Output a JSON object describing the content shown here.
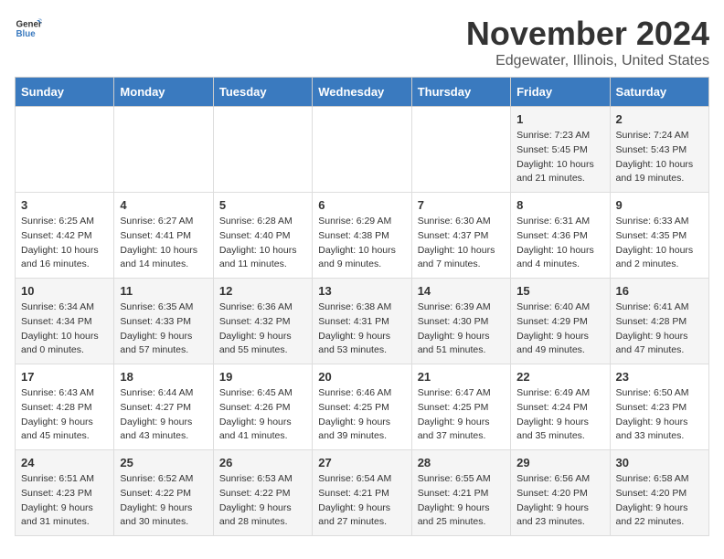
{
  "logo": {
    "general": "General",
    "blue": "Blue"
  },
  "title": "November 2024",
  "location": "Edgewater, Illinois, United States",
  "days_of_week": [
    "Sunday",
    "Monday",
    "Tuesday",
    "Wednesday",
    "Thursday",
    "Friday",
    "Saturday"
  ],
  "weeks": [
    [
      {
        "day": "",
        "info": ""
      },
      {
        "day": "",
        "info": ""
      },
      {
        "day": "",
        "info": ""
      },
      {
        "day": "",
        "info": ""
      },
      {
        "day": "",
        "info": ""
      },
      {
        "day": "1",
        "info": "Sunrise: 7:23 AM\nSunset: 5:45 PM\nDaylight: 10 hours\nand 21 minutes."
      },
      {
        "day": "2",
        "info": "Sunrise: 7:24 AM\nSunset: 5:43 PM\nDaylight: 10 hours\nand 19 minutes."
      }
    ],
    [
      {
        "day": "3",
        "info": "Sunrise: 6:25 AM\nSunset: 4:42 PM\nDaylight: 10 hours\nand 16 minutes."
      },
      {
        "day": "4",
        "info": "Sunrise: 6:27 AM\nSunset: 4:41 PM\nDaylight: 10 hours\nand 14 minutes."
      },
      {
        "day": "5",
        "info": "Sunrise: 6:28 AM\nSunset: 4:40 PM\nDaylight: 10 hours\nand 11 minutes."
      },
      {
        "day": "6",
        "info": "Sunrise: 6:29 AM\nSunset: 4:38 PM\nDaylight: 10 hours\nand 9 minutes."
      },
      {
        "day": "7",
        "info": "Sunrise: 6:30 AM\nSunset: 4:37 PM\nDaylight: 10 hours\nand 7 minutes."
      },
      {
        "day": "8",
        "info": "Sunrise: 6:31 AM\nSunset: 4:36 PM\nDaylight: 10 hours\nand 4 minutes."
      },
      {
        "day": "9",
        "info": "Sunrise: 6:33 AM\nSunset: 4:35 PM\nDaylight: 10 hours\nand 2 minutes."
      }
    ],
    [
      {
        "day": "10",
        "info": "Sunrise: 6:34 AM\nSunset: 4:34 PM\nDaylight: 10 hours\nand 0 minutes."
      },
      {
        "day": "11",
        "info": "Sunrise: 6:35 AM\nSunset: 4:33 PM\nDaylight: 9 hours\nand 57 minutes."
      },
      {
        "day": "12",
        "info": "Sunrise: 6:36 AM\nSunset: 4:32 PM\nDaylight: 9 hours\nand 55 minutes."
      },
      {
        "day": "13",
        "info": "Sunrise: 6:38 AM\nSunset: 4:31 PM\nDaylight: 9 hours\nand 53 minutes."
      },
      {
        "day": "14",
        "info": "Sunrise: 6:39 AM\nSunset: 4:30 PM\nDaylight: 9 hours\nand 51 minutes."
      },
      {
        "day": "15",
        "info": "Sunrise: 6:40 AM\nSunset: 4:29 PM\nDaylight: 9 hours\nand 49 minutes."
      },
      {
        "day": "16",
        "info": "Sunrise: 6:41 AM\nSunset: 4:28 PM\nDaylight: 9 hours\nand 47 minutes."
      }
    ],
    [
      {
        "day": "17",
        "info": "Sunrise: 6:43 AM\nSunset: 4:28 PM\nDaylight: 9 hours\nand 45 minutes."
      },
      {
        "day": "18",
        "info": "Sunrise: 6:44 AM\nSunset: 4:27 PM\nDaylight: 9 hours\nand 43 minutes."
      },
      {
        "day": "19",
        "info": "Sunrise: 6:45 AM\nSunset: 4:26 PM\nDaylight: 9 hours\nand 41 minutes."
      },
      {
        "day": "20",
        "info": "Sunrise: 6:46 AM\nSunset: 4:25 PM\nDaylight: 9 hours\nand 39 minutes."
      },
      {
        "day": "21",
        "info": "Sunrise: 6:47 AM\nSunset: 4:25 PM\nDaylight: 9 hours\nand 37 minutes."
      },
      {
        "day": "22",
        "info": "Sunrise: 6:49 AM\nSunset: 4:24 PM\nDaylight: 9 hours\nand 35 minutes."
      },
      {
        "day": "23",
        "info": "Sunrise: 6:50 AM\nSunset: 4:23 PM\nDaylight: 9 hours\nand 33 minutes."
      }
    ],
    [
      {
        "day": "24",
        "info": "Sunrise: 6:51 AM\nSunset: 4:23 PM\nDaylight: 9 hours\nand 31 minutes."
      },
      {
        "day": "25",
        "info": "Sunrise: 6:52 AM\nSunset: 4:22 PM\nDaylight: 9 hours\nand 30 minutes."
      },
      {
        "day": "26",
        "info": "Sunrise: 6:53 AM\nSunset: 4:22 PM\nDaylight: 9 hours\nand 28 minutes."
      },
      {
        "day": "27",
        "info": "Sunrise: 6:54 AM\nSunset: 4:21 PM\nDaylight: 9 hours\nand 27 minutes."
      },
      {
        "day": "28",
        "info": "Sunrise: 6:55 AM\nSunset: 4:21 PM\nDaylight: 9 hours\nand 25 minutes."
      },
      {
        "day": "29",
        "info": "Sunrise: 6:56 AM\nSunset: 4:20 PM\nDaylight: 9 hours\nand 23 minutes."
      },
      {
        "day": "30",
        "info": "Sunrise: 6:58 AM\nSunset: 4:20 PM\nDaylight: 9 hours\nand 22 minutes."
      }
    ]
  ]
}
